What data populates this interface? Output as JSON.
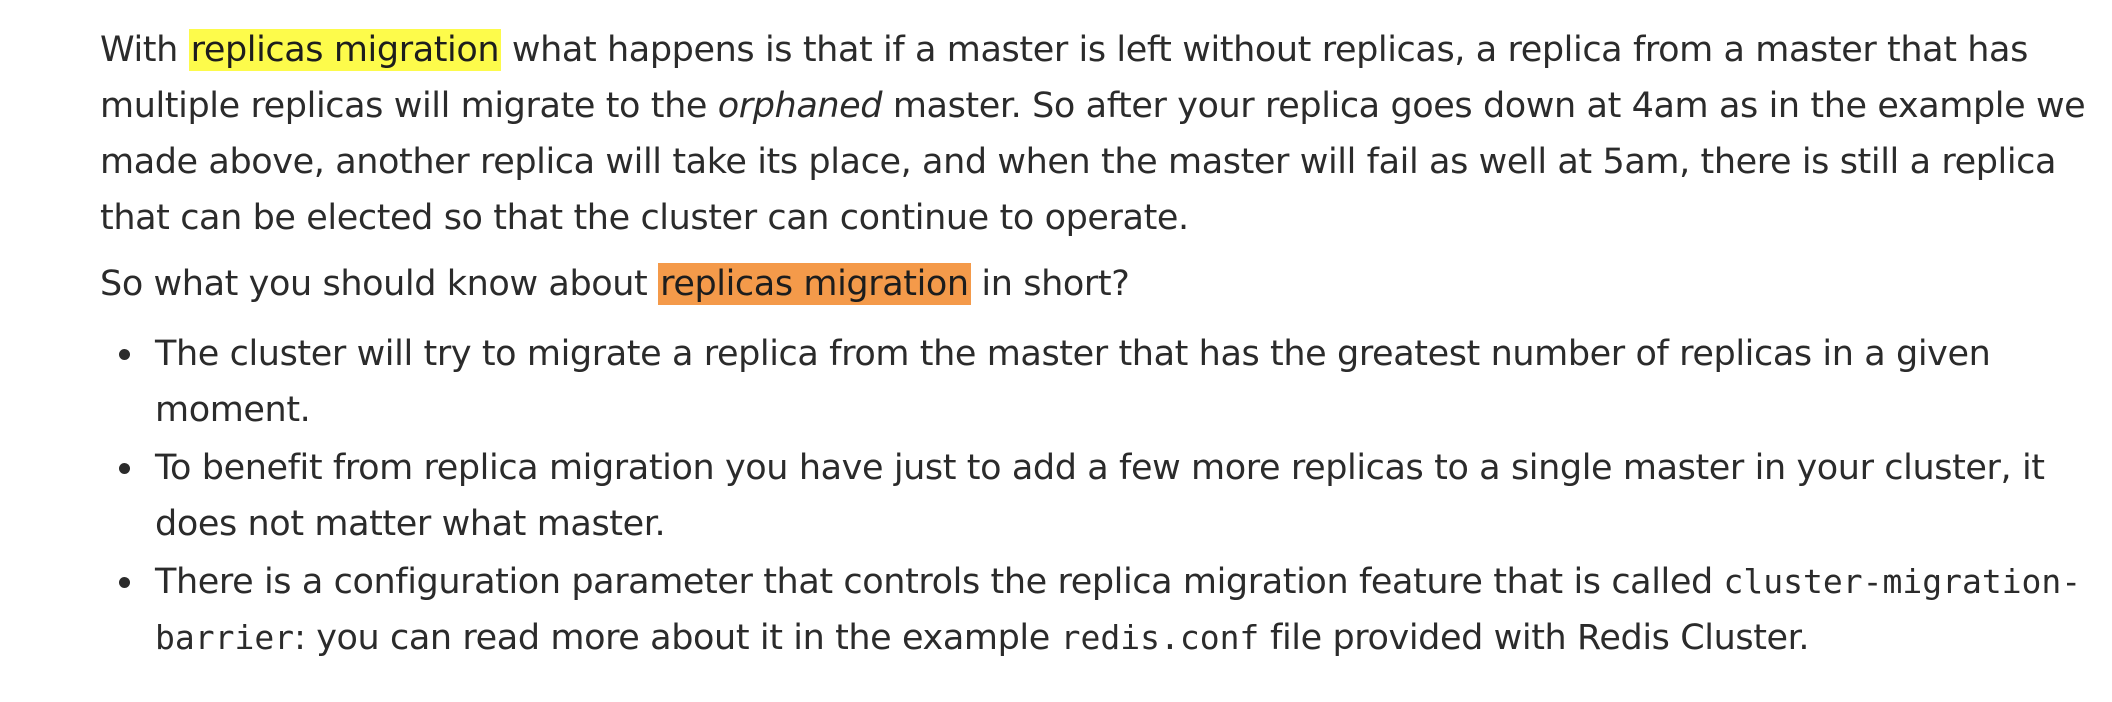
{
  "paragraph1": {
    "before_highlight": "With ",
    "highlight": "replicas migration",
    "mid1": " what happens is that if a master is left without replicas, a replica from a master that has multiple replicas will migrate to the ",
    "emphasis": "orphaned",
    "after": " master. So after your replica goes down at 4am as in the example we made above, another replica will take its place, and when the master will fail as well at 5am, there is still a replica that can be elected so that the cluster can continue to operate."
  },
  "paragraph2": {
    "before_highlight": "So what you should know about ",
    "highlight": "replicas migration",
    "after": " in short?"
  },
  "bullets": [
    {
      "text": "The cluster will try to migrate a replica from the master that has the greatest number of replicas in a given moment."
    },
    {
      "text": "To benefit from replica migration you have just to add a few more replicas to a single master in your cluster, it does not matter what master."
    },
    {
      "text_before_code1": "There is a configuration parameter that controls the replica migration feature that is called ",
      "code1": "cluster-migration-barrier",
      "text_between": ": you can read more about it in the example ",
      "code2": "redis.conf",
      "text_after": " file provided with Redis Cluster."
    }
  ],
  "colors": {
    "highlight_yellow": "#fdfb4b",
    "highlight_orange": "#f49a4a",
    "text": "#2b2b2b"
  }
}
